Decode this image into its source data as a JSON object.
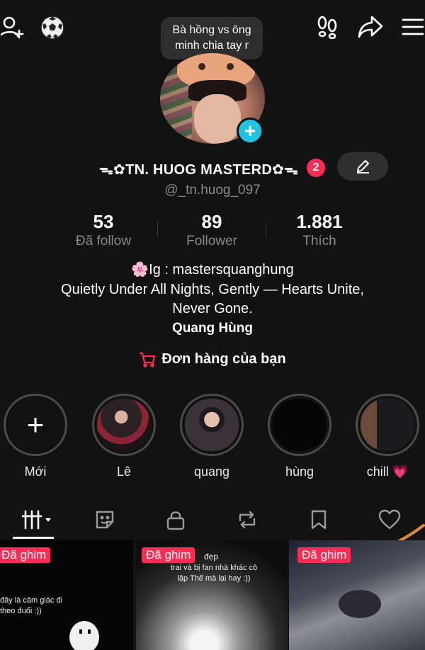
{
  "top_bar": {
    "add_friend_icon": "user-plus-icon",
    "soccer_icon": "soccer-ball-icon",
    "footprint_icon": "footprints-icon",
    "share_icon": "share-arrow-icon",
    "menu_icon": "hamburger-menu-icon",
    "note_bubble": "Bà hồng vs ông minh chia tay r"
  },
  "profile": {
    "display_name": "✿TN. HUOG MASTERD✿",
    "name_prefix": "ᯓ",
    "name_suffix": "ᯓ",
    "notification_count": "2",
    "handle": "@_tn.huog_097"
  },
  "stats": [
    {
      "value": "53",
      "label": "Đã follow"
    },
    {
      "value": "89",
      "label": "Follower"
    },
    {
      "value": "1.881",
      "label": "Thích"
    }
  ],
  "bio": {
    "line1": "🌸Ig : mastersquanghung",
    "line2": "Quietly Under All Nights, Gently — Hearts Unite,",
    "line3": "Never Gone.",
    "name": "Quang Hùng"
  },
  "orders_label": "Đơn hàng của bạn",
  "highlights": [
    {
      "label": "Mới"
    },
    {
      "label": "Lê"
    },
    {
      "label": "quang"
    },
    {
      "label": "hùng"
    },
    {
      "label": "chill 💗"
    }
  ],
  "tabs": [
    "grid-icon",
    "sticker-icon",
    "lock-icon",
    "repost-icon",
    "bookmark-icon",
    "heart-icon"
  ],
  "grid": [
    {
      "pin": "Đã ghim",
      "text": "đây là cảm giác đi theo đuổi :))"
    },
    {
      "pin": "Đã ghim",
      "text_after_pin": "đẹp",
      "text": "trai và bị fan nhà khác cô lập Thế mà lại hay :))"
    },
    {
      "pin": "Đã ghim"
    }
  ],
  "colors": {
    "background": "#121212",
    "accent_red": "#fe2c55",
    "accent_cyan": "#20c3e3",
    "muted_text": "#8a8a8a"
  }
}
